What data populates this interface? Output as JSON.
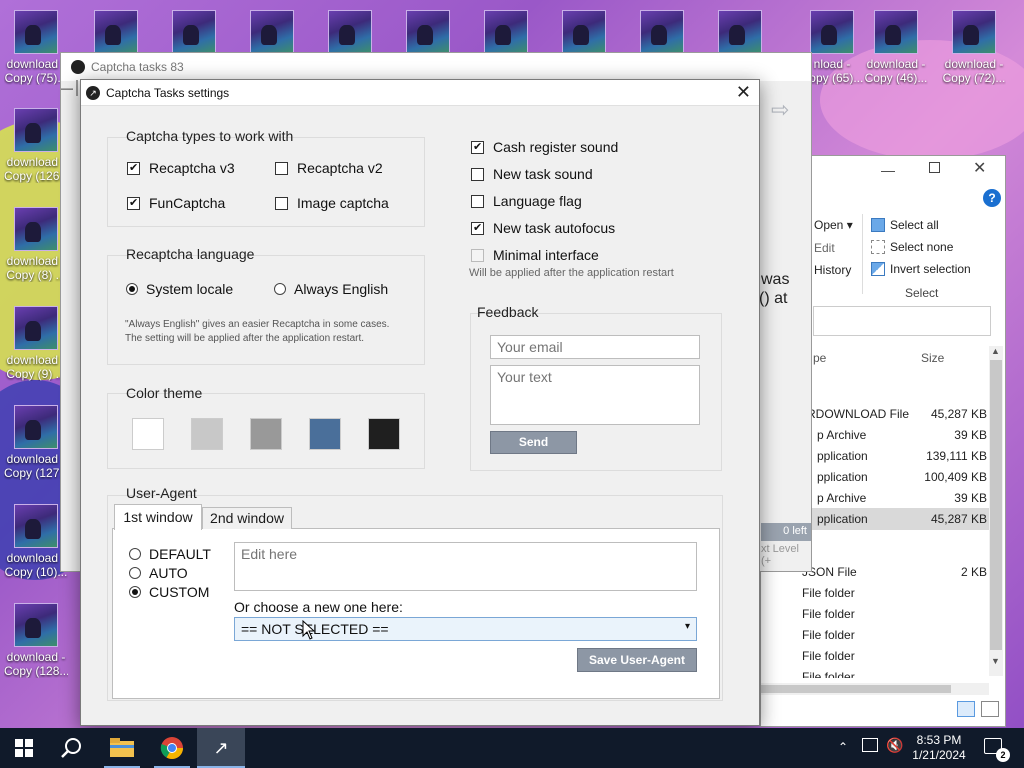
{
  "desktop": {
    "icons": [
      {
        "label": "download -",
        "label2": "Copy (75)..."
      },
      {
        "label": "download -",
        "label2": "Copy (126..."
      },
      {
        "label": "download -",
        "label2": "Copy (8) ..."
      },
      {
        "label": "download -",
        "label2": "Copy (9) ..."
      },
      {
        "label": "download -",
        "label2": "Copy (127..."
      },
      {
        "label": "download -",
        "label2": "Copy (10)..."
      },
      {
        "label": "download -",
        "label2": "Copy (128..."
      }
    ],
    "top_icons": [
      {
        "label": "nload -",
        "label2": "Copy (65)..."
      },
      {
        "label": "download -",
        "label2": "Copy (46)..."
      },
      {
        "label": "download -",
        "label2": "Copy (72)..."
      }
    ]
  },
  "bg_app": {
    "title": "Captcha tasks 83",
    "side_text1": "was",
    "side_text2": "() at",
    "left_count": "0 left",
    "text_level": "xt Level (+"
  },
  "explorer": {
    "ribbon": {
      "open": "Open",
      "edit": "Edit",
      "history": "History",
      "select_all": "Select all",
      "select_none": "Select none",
      "invert": "Invert selection",
      "select_group": "Select"
    },
    "col_type": "pe",
    "col_size": "Size",
    "rows": [
      {
        "type": "RDOWNLOAD File",
        "size": "45,287 KB"
      },
      {
        "type": "p Archive",
        "size": "39 KB"
      },
      {
        "type": "pplication",
        "size": "139,111 KB"
      },
      {
        "type": "pplication",
        "size": "100,409 KB"
      },
      {
        "type": "p Archive",
        "size": "39 KB"
      },
      {
        "type": "pplication",
        "size": "45,287 KB"
      },
      {
        "type": "JSON File",
        "size": "2 KB"
      },
      {
        "type": "File folder",
        "size": ""
      },
      {
        "type": "File folder",
        "size": ""
      },
      {
        "type": "File folder",
        "size": ""
      },
      {
        "type": "File folder",
        "size": ""
      },
      {
        "type": "File folder",
        "size": ""
      }
    ]
  },
  "dialog": {
    "title": "Captcha Tasks settings",
    "captcha_types": {
      "title": "Captcha types to work with",
      "recaptcha_v3": "Recaptcha v3",
      "recaptcha_v2": "Recaptcha v2",
      "funcaptcha": "FunCaptcha",
      "image_captcha": "Image captcha"
    },
    "recaptcha_lang": {
      "title": "Recaptcha language",
      "system_locale": "System locale",
      "always_english": "Always English",
      "note1": "\"Always English\" gives an easier Recaptcha in some cases.",
      "note2": "The setting will be applied after the application restart."
    },
    "color_theme": {
      "title": "Color theme",
      "colors": [
        "#ffffff",
        "#c8c8c8",
        "#999999",
        "#4a6f9a",
        "#1f1f1f"
      ]
    },
    "options": {
      "cash_register": "Cash register sound",
      "new_task_sound": "New task sound",
      "language_flag": "Language flag",
      "new_task_autofocus": "New task autofocus",
      "minimal_interface": "Minimal interface",
      "restart_note": "Will be applied after the application restart"
    },
    "feedback": {
      "title": "Feedback",
      "email_placeholder": "Your email",
      "text_placeholder": "Your text",
      "send": "Send"
    },
    "user_agent": {
      "title": "User-Agent",
      "tab1": "1st window",
      "tab2": "2nd window",
      "default": "DEFAULT",
      "auto": "AUTO",
      "custom": "CUSTOM",
      "edit_placeholder": "Edit here",
      "choose_label": "Or choose a new one here:",
      "select_value": "== NOT SELECTED ==",
      "save": "Save User-Agent"
    }
  },
  "taskbar": {
    "time": "8:53 PM",
    "date": "1/21/2024"
  }
}
